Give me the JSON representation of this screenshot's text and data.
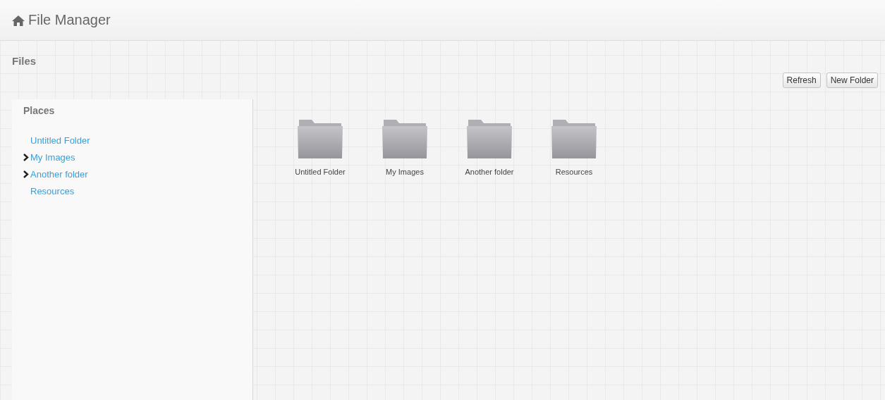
{
  "header": {
    "title": "File Manager"
  },
  "section": {
    "title": "Files"
  },
  "toolbar": {
    "buttons": [
      "Refresh",
      "New Folder"
    ]
  },
  "sidebar": {
    "title": "Places",
    "items": [
      {
        "label": "Untitled Folder",
        "expandable": false
      },
      {
        "label": "My Images",
        "expandable": true
      },
      {
        "label": "Another folder",
        "expandable": true
      },
      {
        "label": "Resources",
        "expandable": false
      }
    ]
  },
  "folders": [
    {
      "name": "Untitled Folder"
    },
    {
      "name": "My Images"
    },
    {
      "name": "Another folder"
    },
    {
      "name": "Resources"
    }
  ]
}
